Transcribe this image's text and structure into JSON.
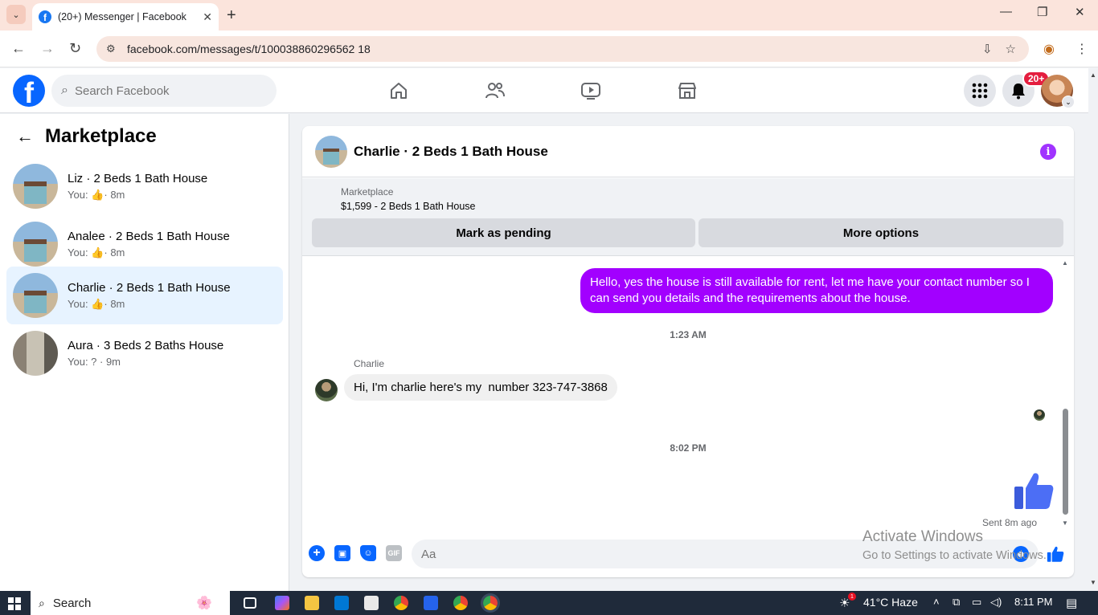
{
  "browser": {
    "tab_title": "(20+) Messenger | Facebook",
    "url": "facebook.com/messages/t/100038860296562 18"
  },
  "fb": {
    "search_placeholder": "Search Facebook",
    "notif_badge": "20+"
  },
  "left": {
    "title": "Marketplace",
    "conversations": [
      {
        "name": "Liz · 2 Beds 1 Bath House",
        "sub_prefix": "You:",
        "sub_time": "· 8m",
        "like": true
      },
      {
        "name": "Analee · 2 Beds 1 Bath House",
        "sub_prefix": "You:",
        "sub_time": "· 8m",
        "like": true
      },
      {
        "name": "Charlie · 2 Beds 1 Bath House",
        "sub_prefix": "You:",
        "sub_time": "· 8m",
        "like": true
      },
      {
        "name": "Aura · 3 Beds 2 Baths House",
        "sub_prefix": "You: ? · 9m",
        "sub_time": "",
        "like": false
      }
    ]
  },
  "chat": {
    "title": "Charlie · 2 Beds 1 Bath House",
    "marketplace_label": "Marketplace",
    "listing": "$1,599 - 2 Beds 1 Bath House",
    "btn_pending": "Mark as pending",
    "btn_more": "More options",
    "outgoing": "Hello, yes the house is still available for rent, let me have your contact number so I can send you details and the requirements about the house.",
    "ts1": "1:23 AM",
    "sender": "Charlie",
    "incoming": "Hi, I'm charlie here's my  number 323-747-3868",
    "ts2": "8:02 PM",
    "sent_status": "Sent 8m ago",
    "composer_placeholder": "Aa"
  },
  "watermark": {
    "line1": "Activate Windows",
    "line2": "Go to Settings to activate Windows."
  },
  "taskbar": {
    "search": "Search",
    "weather": "41°C  Haze",
    "time": "8:11 PM"
  },
  "colors": {
    "fb_blue": "#0866ff",
    "outgoing_bubble": "#a200ff",
    "active_conv": "#e7f3ff"
  }
}
